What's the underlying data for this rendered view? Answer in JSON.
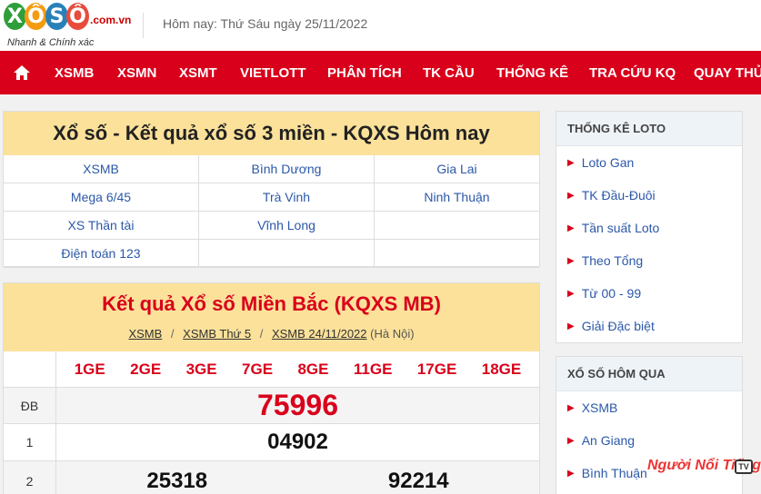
{
  "header": {
    "logo_letters": [
      "X",
      "Ổ",
      "S",
      "Ố"
    ],
    "logo_colors": [
      "#2e9e3a",
      "#f39c12",
      "#2980b9",
      "#e74c3c"
    ],
    "logo_domain": ".com.vn",
    "logo_slogan": "Nhanh & Chính xác",
    "today": "Hôm nay: Thứ Sáu ngày 25/11/2022"
  },
  "nav": {
    "home_icon": "home-icon",
    "items": [
      "XSMB",
      "XSMN",
      "XSMT",
      "VIETLOTT",
      "PHÂN TÍCH",
      "TK CẦU",
      "THỐNG KÊ",
      "TRA CỨU KQ",
      "QUAY THỬ"
    ]
  },
  "main": {
    "title": "Xổ số - Kết quả xổ số 3 miền - KQXS Hôm nay",
    "links": [
      "XSMB",
      "Bình Dương",
      "Gia Lai",
      "Mega 6/45",
      "Trà Vinh",
      "Ninh Thuận",
      "XS Thần tài",
      "Vĩnh Long",
      "",
      "Điện toán 123",
      "",
      ""
    ]
  },
  "results": {
    "title": "Kết quả Xổ số Miền Bắc (KQXS MB)",
    "breadcrumb": [
      "XSMB",
      "XSMB Thứ 5",
      "XSMB 24/11/2022"
    ],
    "region": "(Hà Nội)",
    "codes": [
      "1GE",
      "2GE",
      "3GE",
      "7GE",
      "8GE",
      "11GE",
      "17GE",
      "18GE"
    ],
    "prizes": [
      {
        "label": "ĐB",
        "values": [
          "75996"
        ]
      },
      {
        "label": "1",
        "values": [
          "04902"
        ]
      },
      {
        "label": "2",
        "values": [
          "25318",
          "92214"
        ]
      }
    ]
  },
  "sidebar": {
    "stats_title": "THỐNG KÊ LOTO",
    "stats_items": [
      "Loto Gan",
      "TK Đầu-Đuôi",
      "Tần suất Loto",
      "Theo Tổng",
      "Từ 00 - 99",
      "Giải Đặc biệt"
    ],
    "yesterday_title": "XỔ SỐ HÔM QUA",
    "yesterday_items": [
      "XSMB",
      "An Giang",
      "Bình Thuận"
    ]
  },
  "watermark": {
    "text": "Người Nổi Tiếng",
    "badge": "TV"
  }
}
